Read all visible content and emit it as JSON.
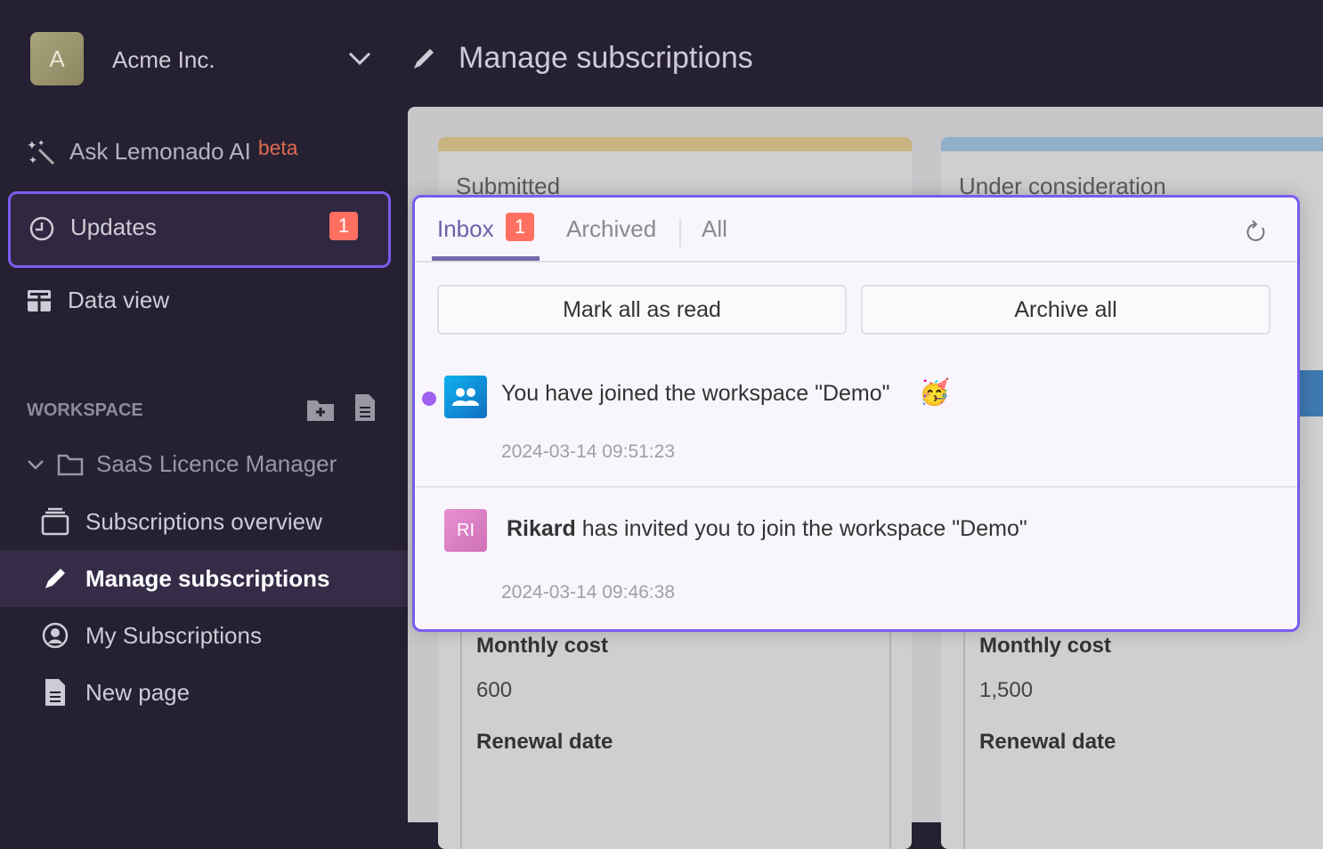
{
  "org": {
    "initial": "A",
    "name": "Acme Inc."
  },
  "header": {
    "title": "Manage subscriptions"
  },
  "sidebar": {
    "ai": {
      "label": "Ask Lemonado AI",
      "tag": "beta"
    },
    "updates": {
      "label": "Updates",
      "count": "1"
    },
    "data_view": "Data view",
    "workspace_label": "WORKSPACE",
    "folder": "SaaS Licence Manager",
    "items": [
      {
        "label": "Subscriptions overview",
        "icon": "stack-icon"
      },
      {
        "label": "Manage subscriptions",
        "icon": "pencil-icon",
        "active": true
      },
      {
        "label": "My Subscriptions",
        "icon": "user-circle-icon"
      },
      {
        "label": "New page",
        "icon": "document-icon"
      }
    ]
  },
  "board": {
    "columns": [
      {
        "title": "Submitted",
        "color": "#c8b47e",
        "monthly_cost_label": "Monthly cost",
        "monthly_cost": "600",
        "renewal_label": "Renewal date"
      },
      {
        "title": "Under consideration",
        "color": "#8fb0c8",
        "monthly_cost_label": "Monthly cost",
        "monthly_cost": "1,500",
        "renewal_label": "Renewal date"
      }
    ]
  },
  "popup": {
    "tabs": {
      "inbox": "Inbox",
      "inbox_count": "1",
      "archived": "Archived",
      "all": "All"
    },
    "mark_all": "Mark all as read",
    "archive_all": "Archive all",
    "notifications": [
      {
        "text": "You have joined the workspace \"Demo\"",
        "emoji": "🥳",
        "time": "2024-03-14 09:51:23",
        "unread": true
      },
      {
        "actor": "Rikard",
        "actor_initials": "RI",
        "text": "has invited you to join the workspace \"Demo\"",
        "time": "2024-03-14 09:46:38",
        "unread": false
      }
    ]
  },
  "colors": {
    "accent": "#7b5cf0",
    "badge": "#ff7060",
    "sidebar": "#262033"
  }
}
